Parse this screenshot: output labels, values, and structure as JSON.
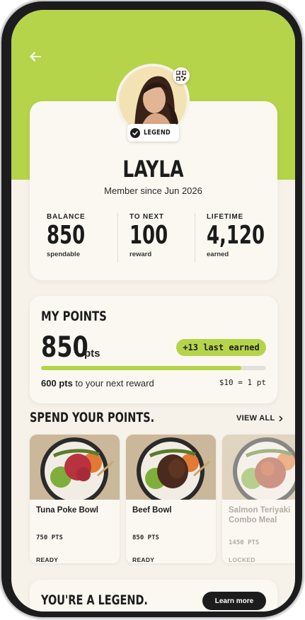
{
  "header": {
    "back_label": "Back"
  },
  "profile": {
    "badge": "LEGEND",
    "name": "LAYLA",
    "member_since": "Member since Jun 2026",
    "stats": [
      {
        "label": "BALANCE",
        "value": "850",
        "sub": "spendable"
      },
      {
        "label": "TO NEXT",
        "value": "100",
        "sub": "reward"
      },
      {
        "label": "LIFETIME",
        "value": "4,120",
        "sub": "earned"
      }
    ]
  },
  "points": {
    "title": "MY POINTS",
    "value": "850",
    "unit": "pts",
    "last_earned": "+13 last earned",
    "progress_fraction": 0.89,
    "next_reward_strong": "600 pts",
    "next_reward_rest": " to your next reward",
    "rate": "$10 = 1 pt"
  },
  "spend": {
    "title": "SPEND YOUR POINTS.",
    "view_all": "VIEW ALL",
    "items": [
      {
        "name": "Tuna Poke Bowl",
        "points": "750 PTS",
        "status": "READY"
      },
      {
        "name": "Beef Bowl",
        "points": "850 PTS",
        "status": "READY"
      },
      {
        "name": "Salmon Teriyaki Combo Meal",
        "points": "1450 PTS",
        "status": "LOCKED"
      }
    ]
  },
  "legend": {
    "title": "YOU'RE A LEGEND.",
    "button": "Learn more"
  },
  "colors": {
    "accent": "#b5d44a",
    "background": "#f6f2ea",
    "card": "#fbf8f2",
    "dark": "#1c1c1c"
  }
}
